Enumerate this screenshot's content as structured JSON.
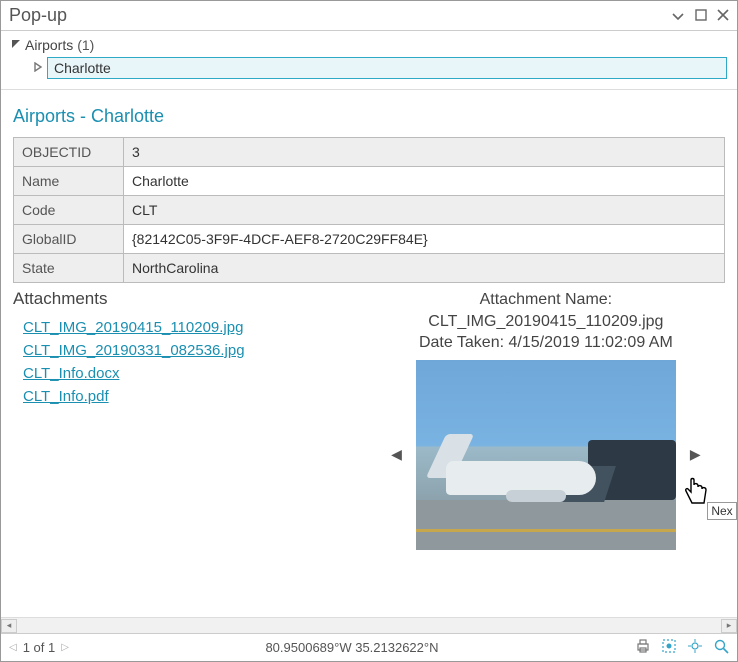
{
  "window": {
    "title": "Pop-up"
  },
  "tree": {
    "root_label": "Airports",
    "root_count": "(1)",
    "child_label": "Charlotte"
  },
  "section_title": "Airports - Charlotte",
  "attributes": {
    "rows": [
      {
        "k": "OBJECTID",
        "v": "3"
      },
      {
        "k": "Name",
        "v": "Charlotte"
      },
      {
        "k": "Code",
        "v": "CLT"
      },
      {
        "k": "GlobalID",
        "v": "{82142C05-3F9F-4DCF-AEF8-2720C29FF84E}"
      },
      {
        "k": "State",
        "v": "NorthCarolina"
      }
    ]
  },
  "attachments": {
    "header": "Attachments",
    "items": [
      "CLT_IMG_20190415_110209.jpg",
      "CLT_IMG_20190331_082536.jpg",
      "CLT_Info.docx",
      "CLT_Info.pdf"
    ]
  },
  "preview": {
    "label_name": "Attachment Name:",
    "file_name": "CLT_IMG_20190415_110209.jpg",
    "label_date_prefix": "Date Taken:",
    "date_value": "4/15/2019 11:02:09 AM",
    "tooltip_next": "Nex"
  },
  "status": {
    "pager": "1 of 1",
    "coords": "80.9500689°W 35.2132622°N"
  },
  "icons": {
    "collapse": "⌄",
    "restore": "▫",
    "close": "✕",
    "tri_down": "◢",
    "tri_right": "▷",
    "tri_left_nav": "◀",
    "tri_right_nav": "▶",
    "prev_page": "◁",
    "next_page": "▷"
  }
}
